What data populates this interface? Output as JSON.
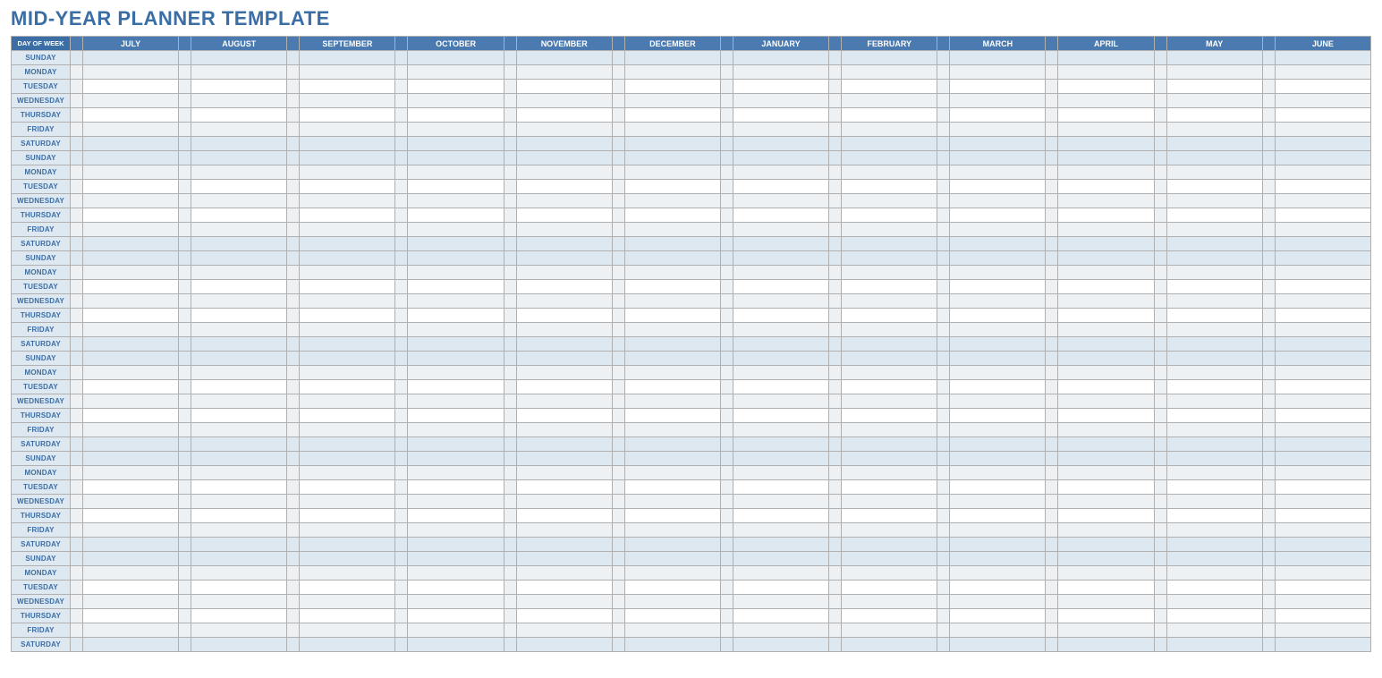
{
  "title": "MID-YEAR PLANNER TEMPLATE",
  "header": {
    "day_of_week": "DAY OF WEEK",
    "months": [
      "JULY",
      "AUGUST",
      "SEPTEMBER",
      "OCTOBER",
      "NOVEMBER",
      "DECEMBER",
      "JANUARY",
      "FEBRUARY",
      "MARCH",
      "APRIL",
      "MAY",
      "JUNE"
    ]
  },
  "days": [
    "SUNDAY",
    "MONDAY",
    "TUESDAY",
    "WEDNESDAY",
    "THURSDAY",
    "FRIDAY",
    "SATURDAY",
    "SUNDAY",
    "MONDAY",
    "TUESDAY",
    "WEDNESDAY",
    "THURSDAY",
    "FRIDAY",
    "SATURDAY",
    "SUNDAY",
    "MONDAY",
    "TUESDAY",
    "WEDNESDAY",
    "THURSDAY",
    "FRIDAY",
    "SATURDAY",
    "SUNDAY",
    "MONDAY",
    "TUESDAY",
    "WEDNESDAY",
    "THURSDAY",
    "FRIDAY",
    "SATURDAY",
    "SUNDAY",
    "MONDAY",
    "TUESDAY",
    "WEDNESDAY",
    "THURSDAY",
    "FRIDAY",
    "SATURDAY",
    "SUNDAY",
    "MONDAY",
    "TUESDAY",
    "WEDNESDAY",
    "THURSDAY",
    "FRIDAY",
    "SATURDAY"
  ],
  "weekend_days": [
    "SUNDAY",
    "SATURDAY"
  ],
  "shade_days": [
    "MONDAY",
    "WEDNESDAY",
    "FRIDAY"
  ]
}
